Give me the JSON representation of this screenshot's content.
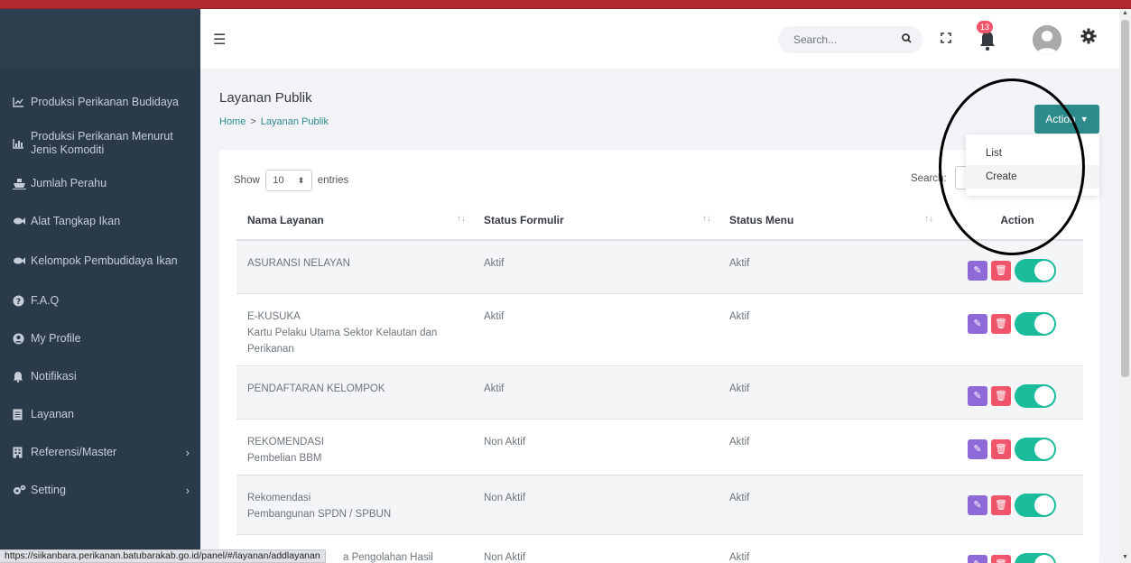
{
  "sidebar": {
    "items": [
      {
        "icon": "chart-line-icon",
        "label": "Produksi Perikanan Budidaya"
      },
      {
        "icon": "chart-bar-icon",
        "label": "Produksi Perikanan Menurut Jenis Komoditi"
      },
      {
        "icon": "ship-icon",
        "label": "Jumlah Perahu"
      },
      {
        "icon": "fish-icon",
        "label": "Alat Tangkap Ikan"
      },
      {
        "icon": "fish-icon",
        "label": "Kelompok Pembudidaya Ikan"
      },
      {
        "icon": "question-circle-icon",
        "label": "F.A.Q"
      },
      {
        "icon": "user-circle-icon",
        "label": "My Profile"
      },
      {
        "icon": "bell-icon",
        "label": "Notifikasi"
      },
      {
        "icon": "document-icon",
        "label": "Layanan"
      },
      {
        "icon": "building-icon",
        "label": "Referensi/Master",
        "chevron": "›"
      },
      {
        "icon": "cogs-icon",
        "label": "Setting",
        "chevron": "›"
      }
    ]
  },
  "header": {
    "search_placeholder": "Search...",
    "notification_count": "13"
  },
  "page": {
    "title": "Layanan Publik",
    "breadcrumb": {
      "home": "Home",
      "separator": ">",
      "current": "Layanan Publik"
    },
    "action_button": "Action",
    "dropdown": {
      "list": "List",
      "create": "Create"
    }
  },
  "table_controls": {
    "show": "Show",
    "entries_value": "10",
    "entries": "entries",
    "search": "Search:"
  },
  "table": {
    "headers": {
      "name": "Nama Layanan",
      "formulir": "Status Formulir",
      "menu": "Status Menu",
      "action": "Action"
    },
    "rows": [
      {
        "name": "ASURANSI NELAYAN",
        "sub": "",
        "formulir": "Aktif",
        "menu": "Aktif"
      },
      {
        "name": "E-KUSUKA",
        "sub": "Kartu Pelaku Utama Sektor Kelautan dan Perikanan",
        "formulir": "Aktif",
        "menu": "Aktif"
      },
      {
        "name": "PENDAFTARAN KELOMPOK",
        "sub": "",
        "formulir": "Aktif",
        "menu": "Aktif"
      },
      {
        "name": "REKOMENDASI",
        "sub": "Pembelian BBM",
        "formulir": "Non Aktif",
        "menu": "Aktif"
      },
      {
        "name": "Rekomendasi",
        "sub": "Pembangunan SPDN / SPBUN",
        "formulir": "Non Aktif",
        "menu": "Aktif"
      },
      {
        "name": "a Pengolahan Hasil",
        "sub": "",
        "formulir": "Non Aktif",
        "menu": "Aktif"
      }
    ]
  },
  "statusbar": {
    "url": "https://siikanbara.perikanan.batubarakab.go.id/panel/#/layanan/addlayanan"
  },
  "colors": {
    "sidebar_bg": "#2b3a4a",
    "accent_teal": "#2e8b8b",
    "edit_purple": "#8e6ad8",
    "delete_red": "#f1556c",
    "toggle_green": "#1abc9c",
    "topbar_red": "#b02a2f"
  }
}
